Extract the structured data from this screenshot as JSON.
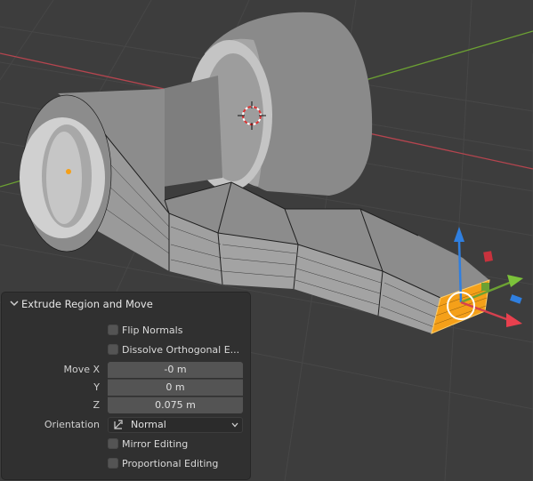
{
  "operator_panel": {
    "title": "Extrude Region and Move",
    "flip_normals": {
      "label": "Flip Normals",
      "checked": false
    },
    "dissolve_orthogonal": {
      "label": "Dissolve Orthogonal E...",
      "checked": false
    },
    "move": {
      "x_label": "Move X",
      "x_value": "-0 m",
      "y_label": "Y",
      "y_value": "0 m",
      "z_label": "Z",
      "z_value": "0.075 m"
    },
    "orientation": {
      "label": "Orientation",
      "value": "Normal"
    },
    "mirror_editing": {
      "label": "Mirror Editing",
      "checked": false
    },
    "proportional_editing": {
      "label": "Proportional Editing",
      "checked": false
    }
  },
  "viewport": {
    "background": "#3d3d3d",
    "x_axis_color": "#b5454f",
    "y_axis_color": "#6ca133",
    "gizmo_z_color": "#2f7fe0",
    "selection_color": "#f5a019"
  }
}
